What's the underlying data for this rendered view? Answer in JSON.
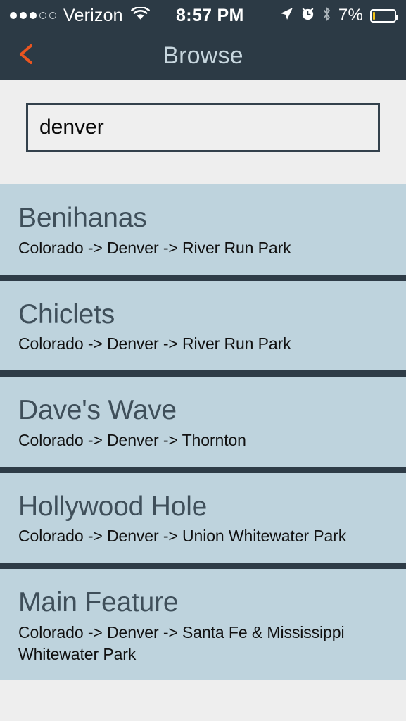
{
  "status_bar": {
    "carrier": "Verizon",
    "signal_dots_filled": 3,
    "signal_dots_empty": 2,
    "wifi_icon": "wifi-icon",
    "time": "8:57 PM",
    "location_icon": "location-arrow-icon",
    "alarm_icon": "alarm-clock-icon",
    "bluetooth_icon": "bluetooth-icon",
    "battery_percent": "7%",
    "battery_level": 7,
    "battery_color": "#f5c518"
  },
  "nav_bar": {
    "back_icon": "chevron-left-icon",
    "back_color": "#ea5520",
    "title": "Browse",
    "title_color": "#c7d6de",
    "background": "#2c3a45"
  },
  "search": {
    "value": "denver",
    "placeholder": "Search"
  },
  "results": [
    {
      "title": "Benihanas",
      "subtitle": "Colorado -> Denver -> River Run Park"
    },
    {
      "title": "Chiclets",
      "subtitle": "Colorado -> Denver -> River Run Park"
    },
    {
      "title": "Dave's Wave",
      "subtitle": "Colorado -> Denver -> Thornton"
    },
    {
      "title": "Hollywood Hole",
      "subtitle": "Colorado -> Denver -> Union Whitewater Park"
    },
    {
      "title": "Main Feature",
      "subtitle": "Colorado -> Denver -> Santa Fe & Mississippi Whitewater Park"
    }
  ],
  "theme": {
    "card_background": "#bed3dd",
    "divider": "#2e3c47",
    "page_background": "#eeeeee",
    "title_color": "#3f4f5a",
    "subtitle_color": "#111111"
  }
}
